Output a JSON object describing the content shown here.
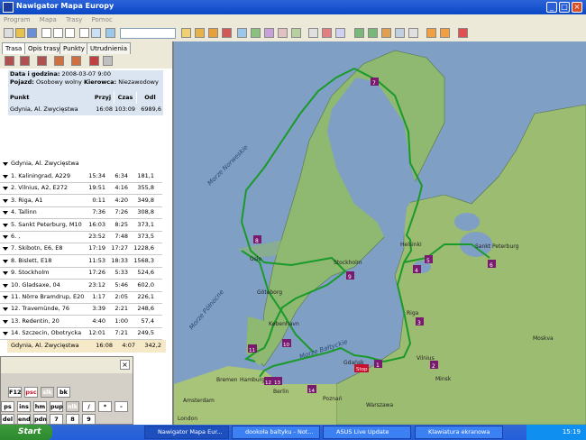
{
  "window": {
    "title": "Nawigator Mapa Europy",
    "controls": [
      "_",
      "□",
      "×"
    ]
  },
  "menu": [
    "Program",
    "Mapa",
    "Trasy",
    "Pomoc"
  ],
  "tabs": [
    "Trasa",
    "Opis trasy",
    "Punkty",
    "Utrudnienia"
  ],
  "info": {
    "date_label": "Data i godzina:",
    "date_value": "2008-03-07 9:00",
    "vehicle_label": "Pojazd:",
    "vehicle_value": "Osobowy wolny",
    "driver_label": "Kierowca:",
    "driver_value": "Niezawodowy"
  },
  "table": {
    "headers": [
      "Punkt",
      "Przyj",
      "Czas",
      "Odl"
    ],
    "summary": [
      "Gdynia, Al. Zwycięstwa",
      "16:08",
      "103:09",
      "6989,6"
    ],
    "start": "Gdynia, Al. Zwycięstwa",
    "rows": [
      [
        "1. Kaliningrad, A229",
        "15:34",
        "6:34",
        "181,1"
      ],
      [
        "2. Vilnius, A2, E272",
        "19:51",
        "4:16",
        "355,8"
      ],
      [
        "3. Riga, A1",
        "0:11",
        "4:20",
        "349,8"
      ],
      [
        "4. Tallinn",
        "7:36",
        "7:26",
        "308,8"
      ],
      [
        "5. Sankt Peterburg, M10",
        "16:03",
        "8:25",
        "373,1"
      ],
      [
        "6. ,",
        "23:52",
        "7:48",
        "373,5"
      ],
      [
        "7. Skibotn, E6, E8",
        "17:19",
        "17:27",
        "1228,6"
      ],
      [
        "8. Bislett, E18",
        "11:53",
        "18:33",
        "1568,3"
      ],
      [
        "9. Stockholm",
        "17:26",
        "5:33",
        "524,6"
      ],
      [
        "10. Gladsaxe, 04",
        "23:12",
        "5:46",
        "602,0"
      ],
      [
        "11. Nörre Bramdrup, E20",
        "1:17",
        "2:05",
        "226,1"
      ],
      [
        "12. Travemünde, 76",
        "3:39",
        "2:21",
        "248,6"
      ],
      [
        "13. Redentin, 20",
        "4:40",
        "1:00",
        "57,4"
      ],
      [
        "14. Szczecin, Obotrycka",
        "12:01",
        "7:21",
        "249,5"
      ]
    ],
    "end": [
      "Gdynia, Al. Zwycięstwa",
      "16:08",
      "4:07",
      "342,2"
    ]
  },
  "map": {
    "cities": {
      "helsinki": "Helsinki",
      "spb": "Sankt Peterburg",
      "oslo": "Oslo",
      "stockholm": "Stockholm",
      "goteborg": "Göteborg",
      "kobenhavn": "København",
      "riga": "Riga",
      "vilnius": "Vilnius",
      "minsk": "Minsk",
      "moskva": "Moskva",
      "gdansk": "Gdańsk",
      "hamburg": "Hamburg",
      "bremen": "Bremen",
      "berlin": "Berlin",
      "poznan": "Poznań",
      "warszawa": "Warszawa",
      "amsterdam": "Amsterdam",
      "london": "London",
      "stop": "Stop"
    },
    "seas": {
      "baltic": "Morze Bałtyckie",
      "norwegian": "Morze Norweskie",
      "north": "Morze Północne"
    },
    "markers": [
      "1",
      "2",
      "3",
      "4",
      "5",
      "6",
      "7",
      "8",
      "9",
      "10",
      "11",
      "12",
      "13",
      "14"
    ]
  },
  "keyboard": {
    "row1": [
      "F12",
      "psc",
      "slk",
      "bk"
    ],
    "row2": [
      "ps",
      "ins",
      "hm",
      "pup",
      "nlk",
      "/",
      "*",
      "-"
    ],
    "row3": [
      "del",
      "end",
      "pdn",
      "7",
      "8",
      "9"
    ]
  },
  "taskbar": {
    "start": "Start",
    "tasks": [
      "Nawigator Mapa Eur...",
      "dookoła baltyku - Not...",
      "ASUS Live Update",
      "Klawiatura ekranowa"
    ],
    "clock": "15:19"
  },
  "colors": {
    "route": "#1a9a2a",
    "marker": "#7a1a6e",
    "water": "#7f9fc4",
    "land": "#8fb870"
  }
}
